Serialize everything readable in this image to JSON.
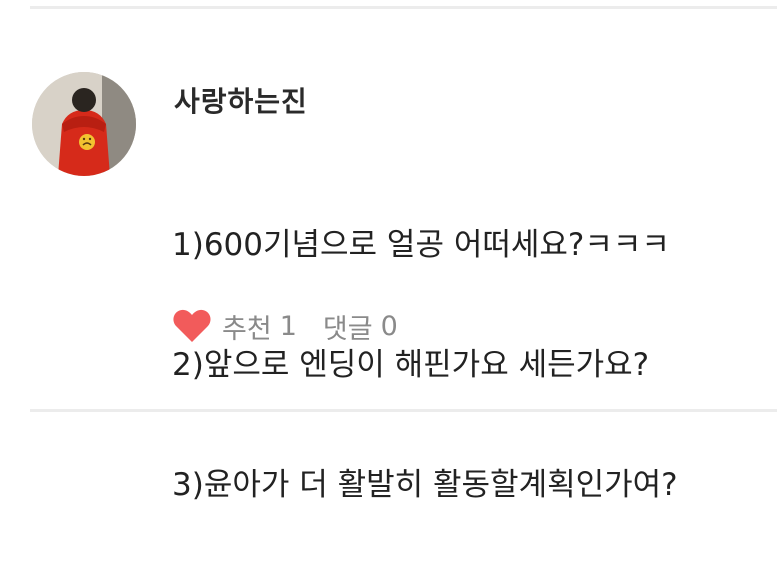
{
  "comment": {
    "author": "사랑하는진",
    "lines": [
      "1)600기념으로 얼공 어떠세요?ㅋㅋㅋ",
      "2)앞으로 엔딩이 해핀가요 세든가요?",
      "3)윤아가 더 활발히 활동할계획인가여?"
    ],
    "like_label": "추천",
    "like_count": "1",
    "comment_label": "댓글",
    "comment_count": "0"
  },
  "colors": {
    "heart": "#f25b5b",
    "divider": "#ececec",
    "meta_text": "#8a8a8a"
  },
  "icons": {
    "like": "heart-icon"
  }
}
